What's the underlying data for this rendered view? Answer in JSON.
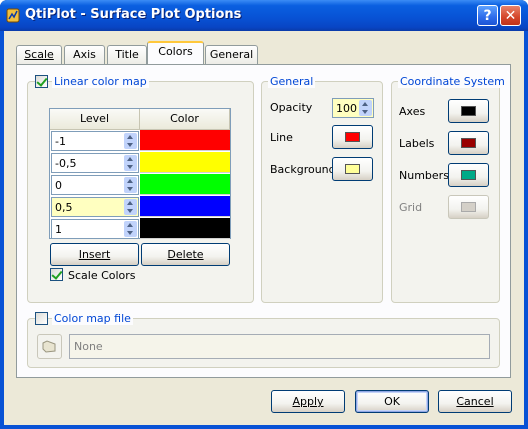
{
  "window": {
    "title": "QtiPlot - Surface Plot Options",
    "help_label": "?",
    "close_label": "✕"
  },
  "tabs": [
    {
      "label": "Scale",
      "active": false
    },
    {
      "label": "Axis",
      "active": false
    },
    {
      "label": "Title",
      "active": false
    },
    {
      "label": "Colors",
      "active": true
    },
    {
      "label": "General",
      "active": false
    }
  ],
  "linear_color_map": {
    "checkbox_label": "Linear color map",
    "checked": true,
    "columns": [
      "Level",
      "Color"
    ],
    "rows": [
      {
        "level": "-1",
        "color": "#ff0000"
      },
      {
        "level": "-0,5",
        "color": "#ffff00"
      },
      {
        "level": "0",
        "color": "#00ff00"
      },
      {
        "level": "0,5",
        "color": "#0000ff"
      },
      {
        "level": "1",
        "color": "#000000"
      }
    ],
    "insert_label": "Insert",
    "delete_label": "Delete",
    "scale_colors_label": "Scale Colors",
    "scale_colors_checked": true
  },
  "general": {
    "title": "General",
    "opacity_label": "Opacity",
    "opacity_value": "100",
    "line_label": "Line",
    "line_color": "#ff0000",
    "background_label": "Background",
    "background_color": "#ffff99"
  },
  "coordinate_system": {
    "title": "Coordinate System",
    "axes_label": "Axes",
    "axes_color": "#000000",
    "labels_label": "Labels",
    "labels_color": "#990000",
    "numbers_label": "Numbers",
    "numbers_color": "#00aa88",
    "grid_label": "Grid",
    "grid_color": "#d4d0c8"
  },
  "color_map_file": {
    "checkbox_label": "Color map file",
    "checked": false,
    "path_value": "None"
  },
  "footer": {
    "apply_label": "Apply",
    "ok_label": "OK",
    "cancel_label": "Cancel"
  }
}
